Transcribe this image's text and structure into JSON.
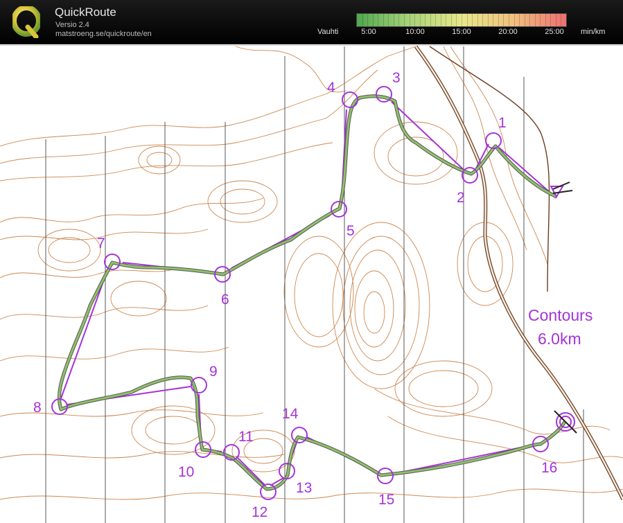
{
  "app": {
    "title": "QuickRoute",
    "version": "Versio 2.4",
    "url": "matstroeng.se/quickroute/en"
  },
  "pace_scale": {
    "label": "Vauhti",
    "unit": "min/km",
    "ticks": [
      "5:00",
      "10:00",
      "15:00",
      "20:00",
      "25:00"
    ],
    "colors": [
      "#4fa84f",
      "#a8d37a",
      "#e8e88a",
      "#f0c080",
      "#ee7070"
    ]
  },
  "map": {
    "info_line1": "Contours",
    "info_line2": "6.0km",
    "course_color": "#a433d8",
    "route_color": "#7fb560",
    "contour_color": "#c87a3c",
    "controls": [
      "1",
      "2",
      "3",
      "4",
      "5",
      "6",
      "7",
      "8",
      "9",
      "10",
      "11",
      "12",
      "13",
      "14",
      "15",
      "16"
    ]
  }
}
